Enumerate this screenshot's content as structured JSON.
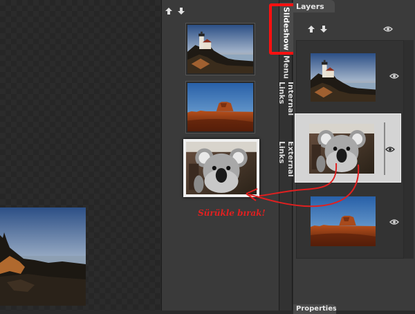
{
  "tabs": {
    "slideshow": "Slideshow",
    "menu": "Menu",
    "internal_links": "Internal Links",
    "external_links": "External Links"
  },
  "panels": {
    "layers": "Layers",
    "properties": "Properties"
  },
  "annotation": {
    "drag_drop": "Sürükle bırak!"
  },
  "icons": {
    "move_up": "arrow-up-icon",
    "move_down": "arrow-down-icon",
    "visibility": "eye-icon"
  },
  "colors": {
    "highlight": "#ff1010",
    "annotation": "#e02020"
  },
  "slides": [
    {
      "name": "lighthouse"
    },
    {
      "name": "desert-mesa"
    },
    {
      "name": "koala",
      "selected": true
    }
  ],
  "layers": [
    {
      "name": "lighthouse"
    },
    {
      "name": "koala",
      "selected": true
    },
    {
      "name": "desert-mesa"
    }
  ]
}
